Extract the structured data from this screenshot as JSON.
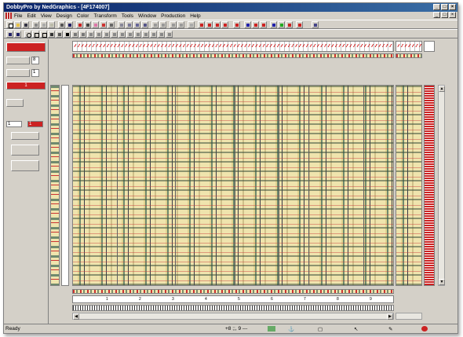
{
  "window": {
    "title": "DobbyPro by NedGraphics - [4F174007]",
    "buttons": [
      "_",
      "□",
      "×"
    ]
  },
  "menu": {
    "items": [
      "File",
      "Edit",
      "View",
      "Design",
      "Color",
      "Transform",
      "Tools",
      "Window",
      "Production",
      "Help"
    ]
  },
  "left_panel": {
    "repeat_value": "8",
    "shaft_value": "1",
    "color_label": "1",
    "num_a": "1",
    "num_b": "1"
  },
  "rulers": {
    "horizontal_ticks": [
      "1",
      "2",
      "3",
      "4",
      "5",
      "6",
      "7",
      "8",
      "9"
    ],
    "vertical_ticks": [
      "1",
      "2",
      "3",
      "4",
      "5",
      "6",
      "7",
      "8",
      "9"
    ]
  },
  "status": {
    "ready": "Ready",
    "coords": "+8 ;;, 9 ---",
    "field_a": "",
    "field_b": ""
  },
  "colors": {
    "accent_red": "#cc2222",
    "fabric_cream": "#efe4ad",
    "fabric_green": "#6f8a6e"
  }
}
